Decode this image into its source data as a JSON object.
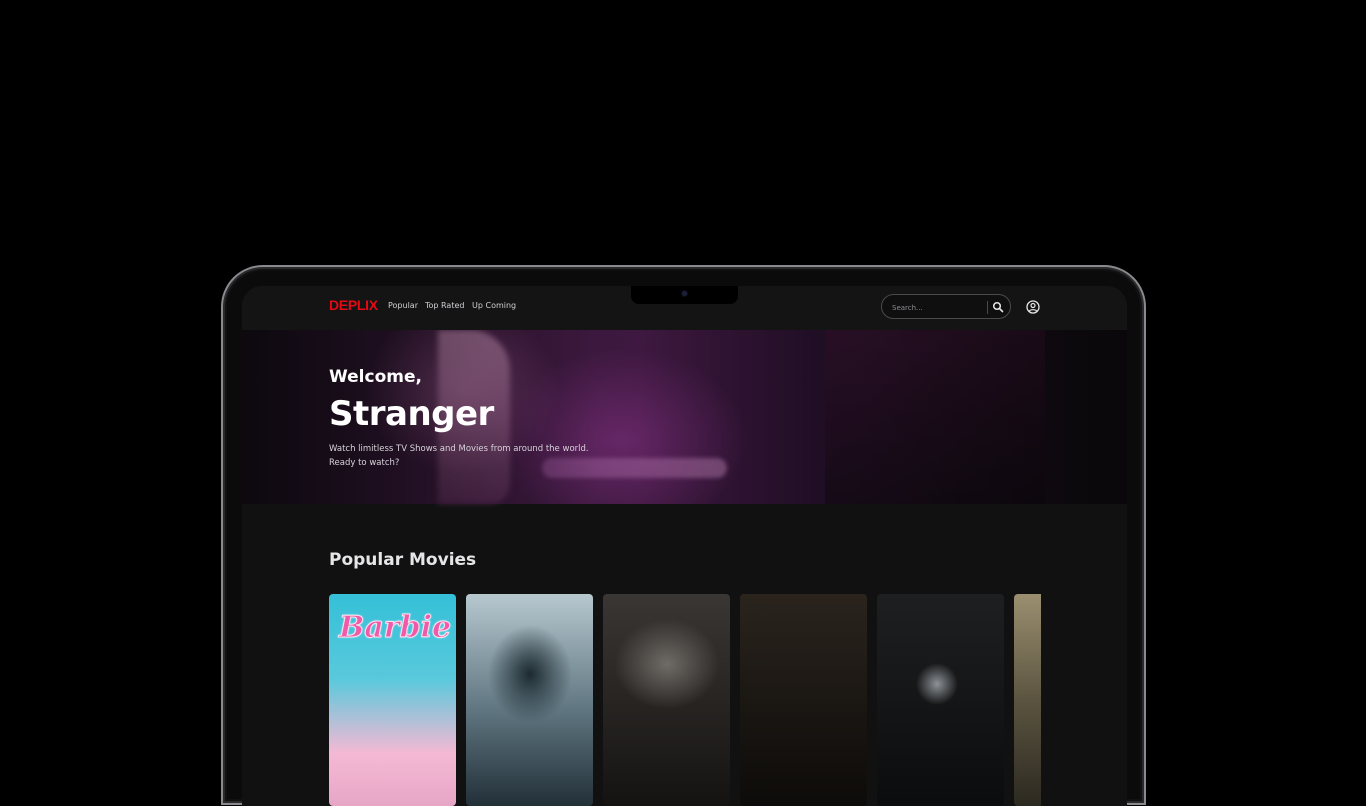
{
  "nav": {
    "logo": "DEPLIX",
    "links": [
      "Popular",
      "Top Rated",
      "Up Coming"
    ],
    "search_placeholder": "Search...",
    "search_icon": "search-icon",
    "user_icon": "user-circle-icon"
  },
  "hero": {
    "greeting": "Welcome,",
    "name": "Stranger",
    "line1": "Watch limitless TV Shows and Movies from around the world.",
    "line2": "Ready to watch?"
  },
  "popular": {
    "title": "Popular Movies",
    "cards": [
      {
        "poster_title": "Barbie",
        "colors": [
          "#e94f9a",
          "#34c0d8",
          "#f4b9d4"
        ]
      },
      {
        "poster_title": "",
        "colors": [
          "#b7c8cf",
          "#5f7580",
          "#223038"
        ]
      },
      {
        "poster_title": "",
        "colors": [
          "#6f6b66",
          "#3a3633",
          "#151312"
        ]
      },
      {
        "poster_title": "",
        "colors": [
          "#2a241d",
          "#1b1713",
          "#0d0b09"
        ]
      },
      {
        "poster_title": "",
        "colors": [
          "#1d1f21",
          "#141617",
          "#0b0c0d"
        ]
      },
      {
        "poster_title": "",
        "colors": [
          "#9b8f70",
          "#5b5440",
          "#2c2920"
        ]
      }
    ]
  },
  "colors": {
    "brand": "#e50914",
    "background": "#111112"
  }
}
